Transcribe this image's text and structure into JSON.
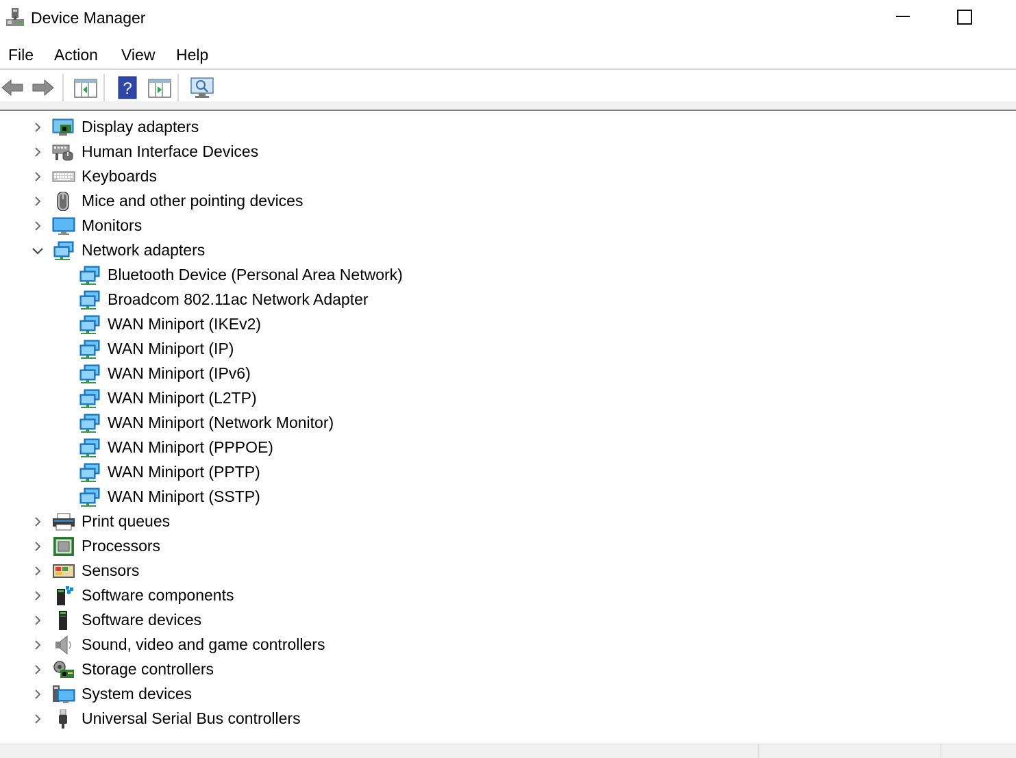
{
  "window": {
    "title": "Device Manager"
  },
  "menu": [
    {
      "label": "File"
    },
    {
      "label": "Action"
    },
    {
      "label": "View"
    },
    {
      "label": "Help"
    }
  ],
  "toolbar": {
    "buttons": [
      "back-icon",
      "forward-icon",
      "show-hide-console-tree-icon",
      "help-icon",
      "properties-pane-icon",
      "scan-hardware-icon"
    ]
  },
  "tree": {
    "categories_before": [
      {
        "label": "Display adapters",
        "icon": "display-adapter-icon"
      },
      {
        "label": "Human Interface Devices",
        "icon": "hid-icon"
      },
      {
        "label": "Keyboards",
        "icon": "keyboard-icon"
      },
      {
        "label": "Mice and other pointing devices",
        "icon": "mouse-icon"
      },
      {
        "label": "Monitors",
        "icon": "monitor-icon"
      }
    ],
    "expanded": {
      "label": "Network adapters",
      "icon": "network-adapter-icon",
      "children": [
        {
          "label": "Bluetooth Device (Personal Area Network)"
        },
        {
          "label": "Broadcom 802.11ac Network Adapter"
        },
        {
          "label": "WAN Miniport (IKEv2)"
        },
        {
          "label": "WAN Miniport (IP)"
        },
        {
          "label": "WAN Miniport (IPv6)"
        },
        {
          "label": "WAN Miniport (L2TP)"
        },
        {
          "label": "WAN Miniport (Network Monitor)"
        },
        {
          "label": "WAN Miniport (PPPOE)"
        },
        {
          "label": "WAN Miniport (PPTP)"
        },
        {
          "label": "WAN Miniport (SSTP)"
        }
      ]
    },
    "categories_after": [
      {
        "label": "Print queues",
        "icon": "printer-icon"
      },
      {
        "label": "Processors",
        "icon": "processor-icon"
      },
      {
        "label": "Sensors",
        "icon": "sensor-icon"
      },
      {
        "label": "Software components",
        "icon": "software-component-icon"
      },
      {
        "label": "Software devices",
        "icon": "software-device-icon"
      },
      {
        "label": "Sound, video and game controllers",
        "icon": "speaker-icon"
      },
      {
        "label": "Storage controllers",
        "icon": "storage-controller-icon"
      },
      {
        "label": "System devices",
        "icon": "system-device-icon"
      },
      {
        "label": "Universal Serial Bus controllers",
        "icon": "usb-icon"
      }
    ]
  }
}
